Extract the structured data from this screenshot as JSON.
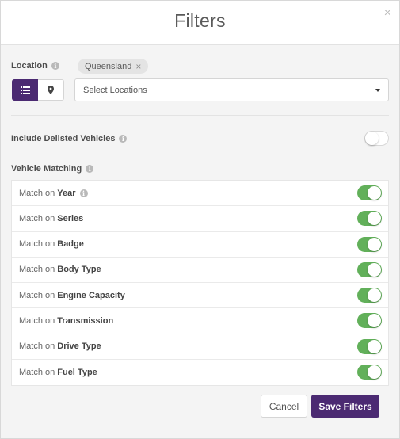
{
  "header": {
    "title": "Filters",
    "close_glyph": "×"
  },
  "location": {
    "label": "Location",
    "info_glyph": "i",
    "chips": [
      {
        "label": "Queensland",
        "remove_glyph": "×"
      }
    ],
    "view_toggle": {
      "list_icon": "list-icon",
      "map_icon": "map-pin-icon",
      "active": "list"
    },
    "select_placeholder": "Select Locations"
  },
  "delisted": {
    "label": "Include Delisted Vehicles",
    "enabled": false
  },
  "vehicle_matching": {
    "label": "Vehicle Matching",
    "prefix": "Match on",
    "rows": [
      {
        "field": "Year",
        "info": true,
        "enabled": true
      },
      {
        "field": "Series",
        "info": false,
        "enabled": true
      },
      {
        "field": "Badge",
        "info": false,
        "enabled": true
      },
      {
        "field": "Body Type",
        "info": false,
        "enabled": true
      },
      {
        "field": "Engine Capacity",
        "info": false,
        "enabled": true
      },
      {
        "field": "Transmission",
        "info": false,
        "enabled": true
      },
      {
        "field": "Drive Type",
        "info": false,
        "enabled": true
      },
      {
        "field": "Fuel Type",
        "info": false,
        "enabled": true
      }
    ]
  },
  "footer": {
    "cancel_label": "Cancel",
    "save_label": "Save Filters"
  },
  "colors": {
    "accent": "#4b2a72",
    "toggle_on": "#62b05a"
  }
}
